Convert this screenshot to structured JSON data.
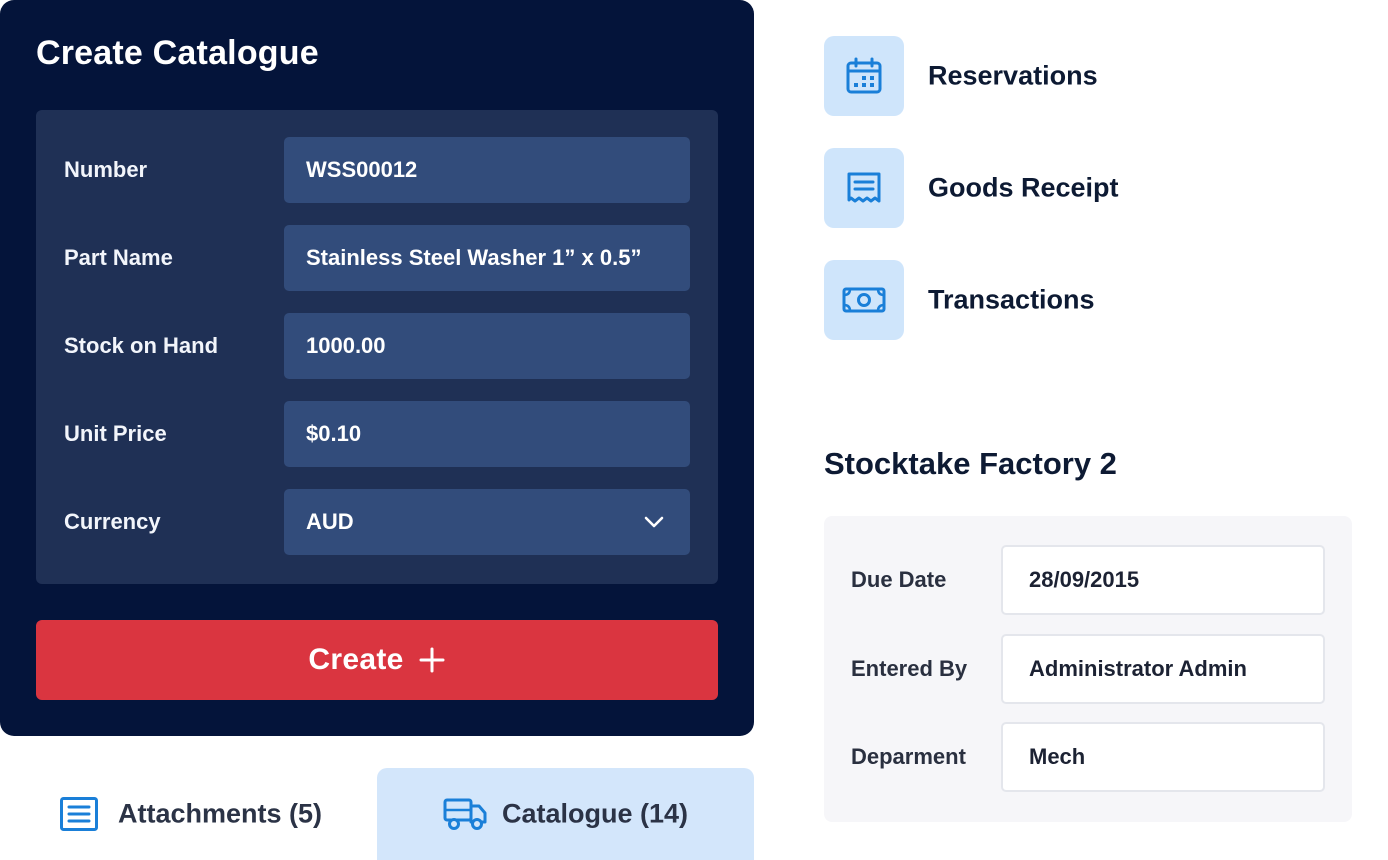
{
  "create_catalogue": {
    "title": "Create Catalogue",
    "fields": [
      {
        "label": "Number",
        "value": "WSS00012"
      },
      {
        "label": "Part Name",
        "value": "Stainless Steel Washer 1” x 0.5”"
      },
      {
        "label": "Stock on Hand",
        "value": "1000.00"
      },
      {
        "label": "Unit Price",
        "value": "$0.10"
      },
      {
        "label": "Currency",
        "value": "AUD"
      }
    ],
    "create_label": "Create"
  },
  "tabs": {
    "attachments": "Attachments (5)",
    "catalogue": "Catalogue (14)"
  },
  "menu": [
    {
      "label": "Reservations",
      "icon": "calendar-icon"
    },
    {
      "label": "Goods Receipt",
      "icon": "receipt-icon"
    },
    {
      "label": "Transactions",
      "icon": "banknote-icon"
    }
  ],
  "stocktake": {
    "title": "Stocktake Factory 2",
    "fields": [
      {
        "label": "Due Date",
        "value": "28/09/2015"
      },
      {
        "label": "Entered By",
        "value": "Administrator Admin"
      },
      {
        "label": "Deparment",
        "value": "Mech"
      }
    ]
  },
  "colors": {
    "card_bg": "#04143a",
    "panel_bg": "#1f3055",
    "input_bg": "#324c7b",
    "create_button": "#da3540",
    "accent_blue": "#1a7fd8",
    "tab_active_bg": "#d3e6fb"
  }
}
